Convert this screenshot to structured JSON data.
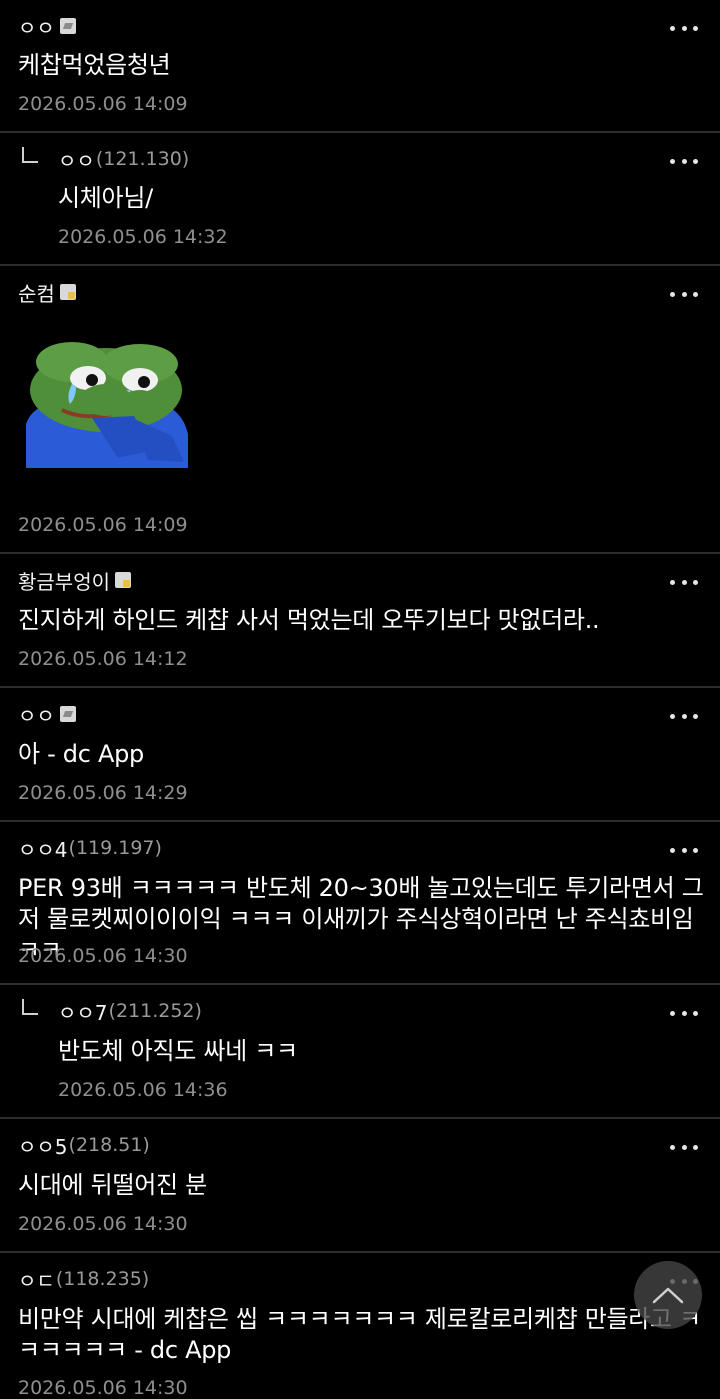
{
  "comments": [
    {
      "nick": "ㅇㅇ",
      "ip": "",
      "body": "케찹먹었음청년",
      "date": "2026.05.06 14:09"
    },
    {
      "nick": "ㅇㅇ",
      "ip": "(121.130)",
      "body": "시체아님/",
      "date": "2026.05.06 14:32"
    },
    {
      "nick": "순컴",
      "ip": "",
      "body": "",
      "date": "2026.05.06 14:09"
    },
    {
      "nick": "황금부엉이",
      "ip": "",
      "body": "진지하게 하인드 케챱 사서 먹었는데 오뚜기보다 맛없더라..",
      "date": "2026.05.06 14:12"
    },
    {
      "nick": "ㅇㅇ",
      "ip": "",
      "body": "아 - dc App",
      "date": "2026.05.06 14:29"
    },
    {
      "nick": "ㅇㅇ4",
      "ip": "(119.197)",
      "body": "PER 93배 ㅋㅋㅋㅋㅋ 반도체 20~30배 놀고있는데도 투기라면서 그저 물로켓찌이이이익 ㅋㅋㅋ 이새끼가 주식상혁이라면 난 주식쵸비임 ㅋㅋ",
      "date": "2026.05.06 14:30"
    },
    {
      "nick": "ㅇㅇ7",
      "ip": "(211.252)",
      "body": "반도체 아직도 싸네 ㅋㅋ",
      "date": "2026.05.06 14:36"
    },
    {
      "nick": "ㅇㅇ5",
      "ip": "(218.51)",
      "body": "시대에 뒤떨어진 분",
      "date": "2026.05.06 14:30"
    },
    {
      "nick": "ㅇㄷ",
      "ip": "(118.235)",
      "body": "비만약 시대에 케챱은 씹 ㅋㅋㅋㅋㅋㅋㅋ 제로칼로리케챱 만들라고 ㅋㅋㅋㅋㅋㅋ - dc App",
      "date": "2026.05.06 14:30"
    }
  ],
  "icons": {
    "more": "more-dots-icon",
    "reply": "reply-arrow-icon",
    "scroll_top": "chevron-up-icon",
    "sticker": "pepe-crying-sticker"
  },
  "colors": {
    "background": "#000000",
    "text": "#ffffff",
    "meta": "#8f8f8f",
    "divider": "#2e2e2e"
  }
}
